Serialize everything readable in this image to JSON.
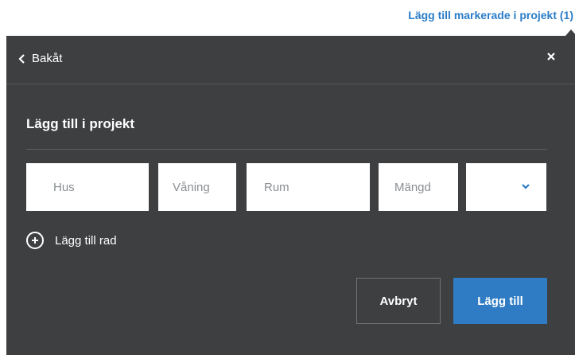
{
  "top_link": "Lägg till markerade i projekt (1)",
  "header": {
    "back_label": "Bakåt"
  },
  "dialog": {
    "title": "Lägg till i projekt",
    "fields": {
      "hus_placeholder": "Hus",
      "vaning_placeholder": "Våning",
      "rum_placeholder": "Rum",
      "mangd_placeholder": "Mängd",
      "unit_selected": ""
    },
    "add_row_label": "Lägg till rad",
    "cancel_label": "Avbryt",
    "submit_label": "Lägg till"
  },
  "icons": {
    "back": "chevron-left-icon",
    "close": "close-icon",
    "dropdown": "chevron-down-icon",
    "add_row": "plus-circle-icon"
  },
  "colors": {
    "accent": "#2f7cc4",
    "link": "#2a7cc7",
    "panel_bg": "#3d3f40"
  }
}
